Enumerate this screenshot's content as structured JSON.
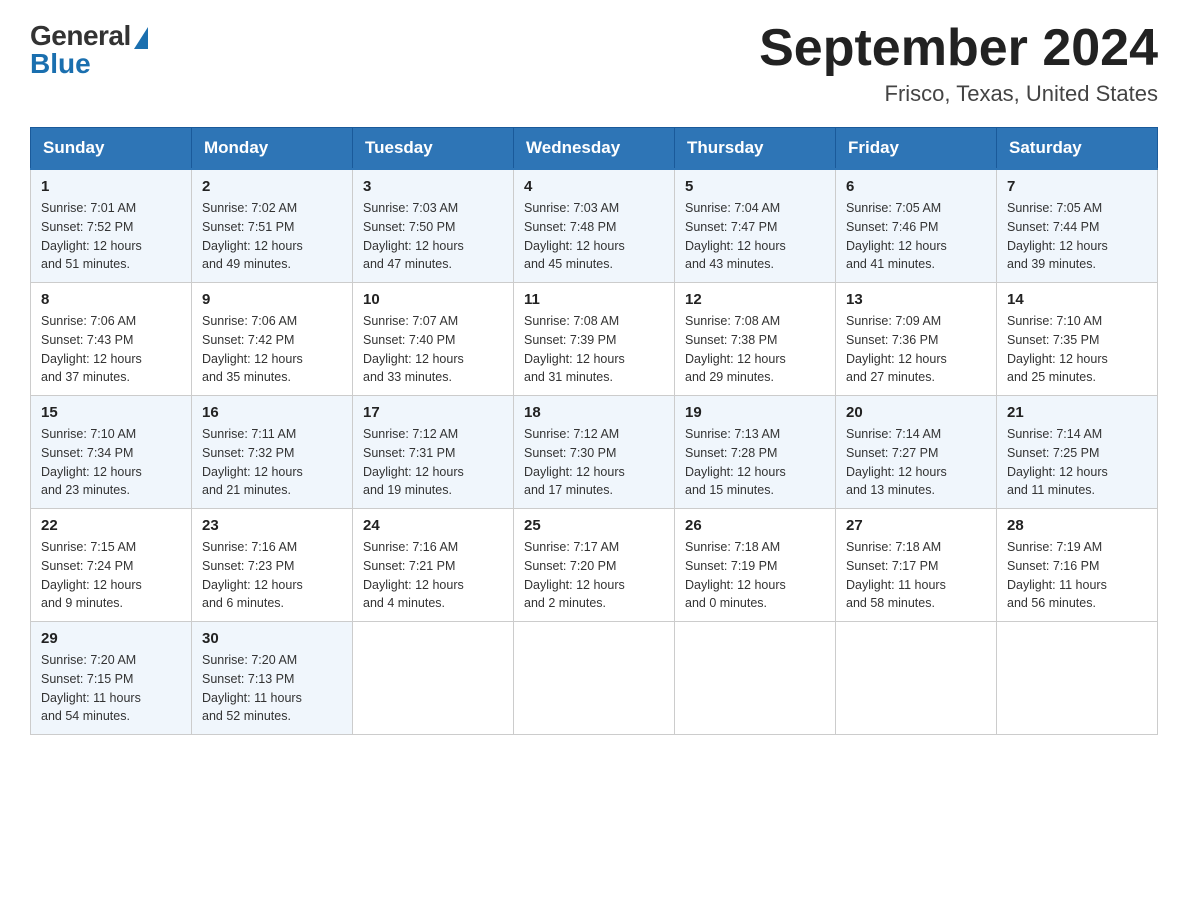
{
  "logo": {
    "general": "General",
    "blue": "Blue"
  },
  "title": {
    "month_year": "September 2024",
    "location": "Frisco, Texas, United States"
  },
  "header": {
    "days": [
      "Sunday",
      "Monday",
      "Tuesday",
      "Wednesday",
      "Thursday",
      "Friday",
      "Saturday"
    ]
  },
  "weeks": [
    [
      {
        "day": "1",
        "sunrise": "7:01 AM",
        "sunset": "7:52 PM",
        "daylight": "12 hours and 51 minutes."
      },
      {
        "day": "2",
        "sunrise": "7:02 AM",
        "sunset": "7:51 PM",
        "daylight": "12 hours and 49 minutes."
      },
      {
        "day": "3",
        "sunrise": "7:03 AM",
        "sunset": "7:50 PM",
        "daylight": "12 hours and 47 minutes."
      },
      {
        "day": "4",
        "sunrise": "7:03 AM",
        "sunset": "7:48 PM",
        "daylight": "12 hours and 45 minutes."
      },
      {
        "day": "5",
        "sunrise": "7:04 AM",
        "sunset": "7:47 PM",
        "daylight": "12 hours and 43 minutes."
      },
      {
        "day": "6",
        "sunrise": "7:05 AM",
        "sunset": "7:46 PM",
        "daylight": "12 hours and 41 minutes."
      },
      {
        "day": "7",
        "sunrise": "7:05 AM",
        "sunset": "7:44 PM",
        "daylight": "12 hours and 39 minutes."
      }
    ],
    [
      {
        "day": "8",
        "sunrise": "7:06 AM",
        "sunset": "7:43 PM",
        "daylight": "12 hours and 37 minutes."
      },
      {
        "day": "9",
        "sunrise": "7:06 AM",
        "sunset": "7:42 PM",
        "daylight": "12 hours and 35 minutes."
      },
      {
        "day": "10",
        "sunrise": "7:07 AM",
        "sunset": "7:40 PM",
        "daylight": "12 hours and 33 minutes."
      },
      {
        "day": "11",
        "sunrise": "7:08 AM",
        "sunset": "7:39 PM",
        "daylight": "12 hours and 31 minutes."
      },
      {
        "day": "12",
        "sunrise": "7:08 AM",
        "sunset": "7:38 PM",
        "daylight": "12 hours and 29 minutes."
      },
      {
        "day": "13",
        "sunrise": "7:09 AM",
        "sunset": "7:36 PM",
        "daylight": "12 hours and 27 minutes."
      },
      {
        "day": "14",
        "sunrise": "7:10 AM",
        "sunset": "7:35 PM",
        "daylight": "12 hours and 25 minutes."
      }
    ],
    [
      {
        "day": "15",
        "sunrise": "7:10 AM",
        "sunset": "7:34 PM",
        "daylight": "12 hours and 23 minutes."
      },
      {
        "day": "16",
        "sunrise": "7:11 AM",
        "sunset": "7:32 PM",
        "daylight": "12 hours and 21 minutes."
      },
      {
        "day": "17",
        "sunrise": "7:12 AM",
        "sunset": "7:31 PM",
        "daylight": "12 hours and 19 minutes."
      },
      {
        "day": "18",
        "sunrise": "7:12 AM",
        "sunset": "7:30 PM",
        "daylight": "12 hours and 17 minutes."
      },
      {
        "day": "19",
        "sunrise": "7:13 AM",
        "sunset": "7:28 PM",
        "daylight": "12 hours and 15 minutes."
      },
      {
        "day": "20",
        "sunrise": "7:14 AM",
        "sunset": "7:27 PM",
        "daylight": "12 hours and 13 minutes."
      },
      {
        "day": "21",
        "sunrise": "7:14 AM",
        "sunset": "7:25 PM",
        "daylight": "12 hours and 11 minutes."
      }
    ],
    [
      {
        "day": "22",
        "sunrise": "7:15 AM",
        "sunset": "7:24 PM",
        "daylight": "12 hours and 9 minutes."
      },
      {
        "day": "23",
        "sunrise": "7:16 AM",
        "sunset": "7:23 PM",
        "daylight": "12 hours and 6 minutes."
      },
      {
        "day": "24",
        "sunrise": "7:16 AM",
        "sunset": "7:21 PM",
        "daylight": "12 hours and 4 minutes."
      },
      {
        "day": "25",
        "sunrise": "7:17 AM",
        "sunset": "7:20 PM",
        "daylight": "12 hours and 2 minutes."
      },
      {
        "day": "26",
        "sunrise": "7:18 AM",
        "sunset": "7:19 PM",
        "daylight": "12 hours and 0 minutes."
      },
      {
        "day": "27",
        "sunrise": "7:18 AM",
        "sunset": "7:17 PM",
        "daylight": "11 hours and 58 minutes."
      },
      {
        "day": "28",
        "sunrise": "7:19 AM",
        "sunset": "7:16 PM",
        "daylight": "11 hours and 56 minutes."
      }
    ],
    [
      {
        "day": "29",
        "sunrise": "7:20 AM",
        "sunset": "7:15 PM",
        "daylight": "11 hours and 54 minutes."
      },
      {
        "day": "30",
        "sunrise": "7:20 AM",
        "sunset": "7:13 PM",
        "daylight": "11 hours and 52 minutes."
      },
      null,
      null,
      null,
      null,
      null
    ]
  ],
  "labels": {
    "sunrise": "Sunrise:",
    "sunset": "Sunset:",
    "daylight": "Daylight:"
  }
}
